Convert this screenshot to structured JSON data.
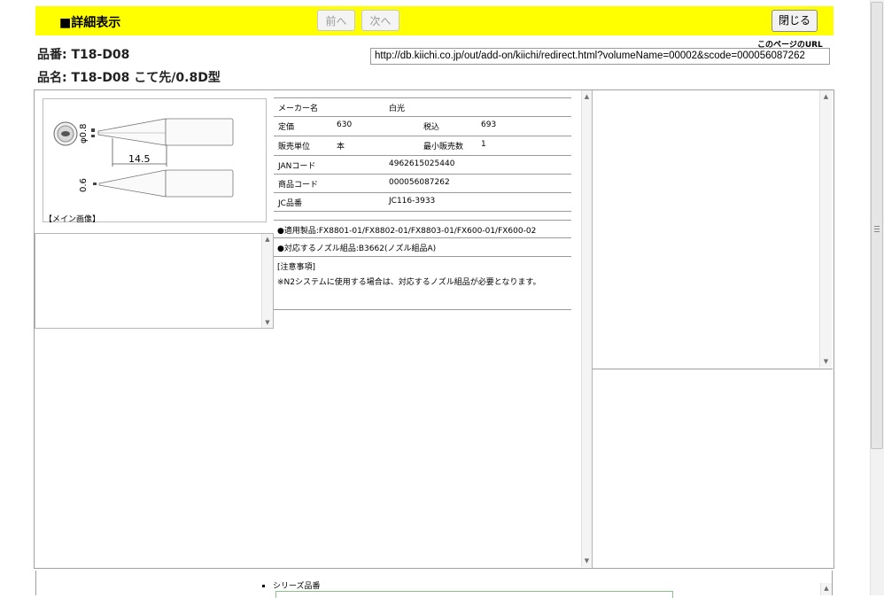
{
  "header": {
    "title": "■詳細表示",
    "prev_label": "前へ",
    "next_label": "次へ",
    "close_label": "閉じる"
  },
  "product": {
    "number_line": "品番: T18-D08",
    "name_line": "品名: T18-D08 こて先/0.8D型"
  },
  "page_url": {
    "label": "このページのURL",
    "value": "http://db.kiichi.co.jp/out/add-on/kiichi/redirect.html?volumeName=00002&scode=000056087262"
  },
  "image": {
    "caption": "【メイン画像】",
    "diameter_label": "φ0.8",
    "length_label": "14.5",
    "thickness_label": "0.6"
  },
  "spec": {
    "maker_label": "メーカー名",
    "maker_value": "白光",
    "price_label": "定価",
    "price_value": "630",
    "tax_label": "税込",
    "tax_value": "693",
    "unit_label": "販売単位",
    "unit_value": "本",
    "min_label": "最小販売数",
    "min_value": "1",
    "jan_label": "JANコード",
    "jan_value": "4962615025440",
    "code_label": "商品コード",
    "code_value": "000056087262",
    "jc_label": "JC品番",
    "jc_value": "JC116-3933",
    "applicable": "●適用製品:FX8801-01/FX8802-01/FX8803-01/FX600-01/FX600-02",
    "nozzle": "●対応するノズル組品:B3662(ノズル組品A)",
    "notes_title": "[注意事項]",
    "notes_body": "※N2システムに使用する場合は、対応するノズル組品が必要となります。"
  },
  "bottom": {
    "series_label": "シリーズ品番"
  }
}
